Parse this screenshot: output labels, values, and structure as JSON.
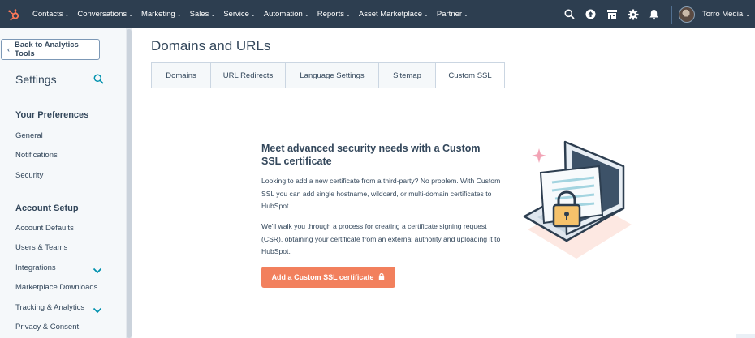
{
  "topnav": {
    "items": [
      {
        "label": "Contacts"
      },
      {
        "label": "Conversations"
      },
      {
        "label": "Marketing"
      },
      {
        "label": "Sales"
      },
      {
        "label": "Service"
      },
      {
        "label": "Automation"
      },
      {
        "label": "Reports"
      },
      {
        "label": "Asset Marketplace"
      },
      {
        "label": "Partner"
      }
    ],
    "icons": [
      "search-icon",
      "upgrade-icon",
      "marketplace-icon",
      "settings-icon",
      "notifications-icon"
    ],
    "account_name": "Torro Media"
  },
  "sidebar": {
    "back_label": "Back to Analytics Tools",
    "title": "Settings",
    "sections": [
      {
        "heading": "Your Preferences",
        "items": [
          "General",
          "Notifications",
          "Security"
        ]
      },
      {
        "heading": "Account Setup",
        "items": [
          "Account Defaults",
          "Users & Teams",
          "Integrations",
          "Marketplace Downloads",
          "Tracking & Analytics",
          "Privacy & Consent"
        ]
      }
    ]
  },
  "main": {
    "title": "Domains and URLs",
    "tabs": [
      {
        "label": "Domains"
      },
      {
        "label": "URL Redirects"
      },
      {
        "label": "Language Settings"
      },
      {
        "label": "Sitemap"
      },
      {
        "label": "Custom SSL"
      }
    ],
    "active_tab": "Custom SSL",
    "card": {
      "title": "Meet advanced security needs with a Custom SSL certificate",
      "paragraph1": "Looking to add a new certificate from a third-party? No problem. With Custom SSL you can add single hostname, wildcard, or multi-domain certificates to HubSpot.",
      "paragraph2": "We'll walk you through a process for creating a certificate signing request (CSR), obtaining your certificate from an external authority and uploading it to HubSpot.",
      "cta_label": "Add a Custom SSL certificate"
    }
  },
  "colors": {
    "nav_bg": "#2d3e50",
    "accent_orange": "#f2805d",
    "text": "#33475b",
    "link_teal": "#0091ae"
  }
}
